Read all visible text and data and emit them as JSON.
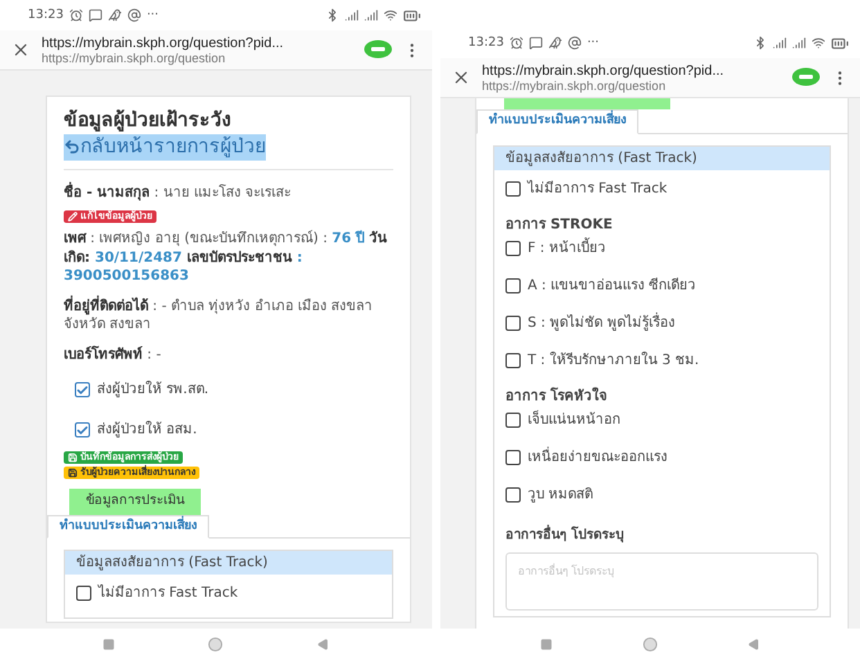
{
  "phones": [
    {
      "status_time": "13:23",
      "status_more": "···",
      "url": "https://mybrain.skph.org/question?pid...",
      "url_sub": "https://mybrain.skph.org/question",
      "blocks": [
        {
          "kind": "title",
          "text": "ข้อมูลผู้ป่วยเฝ้าระวัง",
          "link": "กลับหน้ารายการผู้ป่วย"
        },
        {
          "kind": "detail",
          "parts": [
            {
              "kind": "label",
              "text": "ชื่อ - นามสกุล"
            },
            {
              "kind": "plain",
              "text": " : นาย แมะโสง จะเรเสะ"
            }
          ]
        },
        {
          "kind": "edit_badge",
          "text": "แก้ไขข้อมูลผู้ป่วย"
        },
        {
          "kind": "detail",
          "parts": [
            {
              "kind": "label",
              "text": "เพศ"
            },
            {
              "kind": "plain",
              "text": " : เพศหญิง อายุ (ขณะบันทึกเหตุการณ์) : "
            },
            {
              "kind": "value",
              "text": "76 ปี"
            },
            {
              "kind": "label",
              "text": " วันเกิด: "
            },
            {
              "kind": "value",
              "text": "30/11/2487"
            },
            {
              "kind": "label",
              "text": " เลขบัตรประชาชน"
            },
            {
              "kind": "value",
              "text": " : 3900500156863"
            }
          ]
        },
        {
          "kind": "detail",
          "parts": [
            {
              "kind": "label",
              "text": "ที่อยู่ที่ติดต่อได้"
            },
            {
              "kind": "plain",
              "text": " : - ตำบล ทุ่งหวัง อำเภอ เมือง สงขลา จังหวัด สงขลา"
            }
          ]
        },
        {
          "kind": "detail",
          "parts": [
            {
              "kind": "label",
              "text": "เบอร์โทรศัพท์"
            },
            {
              "kind": "plain",
              "text": " : -"
            }
          ]
        },
        {
          "kind": "checkbox",
          "label": "ส่งผู้ป่วยให้ รพ.สต.",
          "checked": true
        },
        {
          "kind": "checkbox",
          "label": "ส่งผู้ป่วยให้ อสม.",
          "checked": true
        },
        {
          "kind": "save_badge",
          "text": "บันทึกข้อมูลการส่งผู้ป่วย"
        },
        {
          "kind": "risk_badge",
          "text": "รับผู้ป่วยความเสี่ยงปานกลาง"
        },
        {
          "kind": "button",
          "text": "ข้อมูลการประเมิน"
        },
        {
          "kind": "tab",
          "text": "ทำแบบประเมินความเสี่ยง",
          "selected": true
        },
        {
          "kind": "panel",
          "title": "ข้อมูลสงสัยอาการ (Fast Track)",
          "blocks": [
            {
              "kind": "checkbox",
              "label": "ไม่มีอาการ Fast Track",
              "checked": false
            }
          ]
        }
      ]
    },
    {
      "status_time": "13:23",
      "status_more": "···",
      "url": "https://mybrain.skph.org/question?pid...",
      "url_sub": "https://mybrain.skph.org/question",
      "blocks": [
        {
          "kind": "button_stub"
        },
        {
          "kind": "tab",
          "text": "ทำแบบประเมินความเสี่ยง",
          "selected": true
        },
        {
          "kind": "panel",
          "title": "ข้อมูลสงสัยอาการ (Fast Track)",
          "blocks": [
            {
              "kind": "checkbox",
              "label": "ไม่มีอาการ Fast Track",
              "checked": false
            },
            {
              "kind": "section",
              "text": "อาการ STROKE"
            },
            {
              "kind": "checkbox",
              "label": "F : หน้าเบี้ยว",
              "checked": false
            },
            {
              "kind": "checkbox",
              "label": "A : แขนขาอ่อนแรง ซีกเดียว",
              "checked": false
            },
            {
              "kind": "checkbox",
              "label": "S : พูดไม่ชัด พูดไม่รู้เรื่อง",
              "checked": false
            },
            {
              "kind": "checkbox",
              "label": "T : ให้รีบรักษาภายใน 3 ชม.",
              "checked": false
            },
            {
              "kind": "section",
              "text": "อาการ โรคหัวใจ"
            },
            {
              "kind": "checkbox",
              "label": "เจ็บแน่นหน้าอก",
              "checked": false
            },
            {
              "kind": "checkbox",
              "label": "เหนื่อยง่ายขณะออกแรง",
              "checked": false
            },
            {
              "kind": "checkbox",
              "label": "วูบ หมดสติ",
              "checked": false
            },
            {
              "kind": "heading",
              "text": "อาการอื่นๆ โปรดระบุ"
            },
            {
              "kind": "textarea",
              "placeholder": "อาการอื่นๆ โปรดระบุ"
            }
          ]
        }
      ]
    }
  ]
}
